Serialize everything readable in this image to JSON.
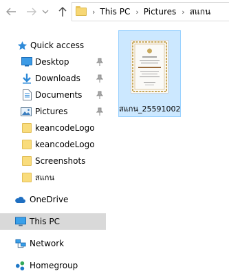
{
  "breadcrumb": [
    "This PC",
    "Pictures",
    "สแกน"
  ],
  "sidebar": {
    "quick_access": "Quick access",
    "items": [
      {
        "label": "Desktop",
        "icon": "desktop-icon",
        "pinned": true
      },
      {
        "label": "Downloads",
        "icon": "download-icon",
        "pinned": true
      },
      {
        "label": "Documents",
        "icon": "documents-icon",
        "pinned": true
      },
      {
        "label": "Pictures",
        "icon": "pictures-icon",
        "pinned": true
      },
      {
        "label": "keancodeLogo",
        "icon": "folder-icon",
        "pinned": false
      },
      {
        "label": "keancodeLogo",
        "icon": "folder-icon",
        "pinned": false
      },
      {
        "label": "Screenshots",
        "icon": "folder-icon",
        "pinned": false
      },
      {
        "label": "สแกน",
        "icon": "folder-icon",
        "pinned": false
      }
    ],
    "onedrive": "OneDrive",
    "this_pc": "This PC",
    "network": "Network",
    "homegroup": "Homegroup"
  },
  "files": [
    {
      "name": "สแกน_25591002",
      "type": "image",
      "selected": true
    }
  ],
  "colors": {
    "selection_bg": "#cce8ff",
    "selection_border": "#99d1ff",
    "nav_selected_bg": "#d9d9d9",
    "folder": "#f9dc7c",
    "accent_blue": "#2e8ad8"
  }
}
